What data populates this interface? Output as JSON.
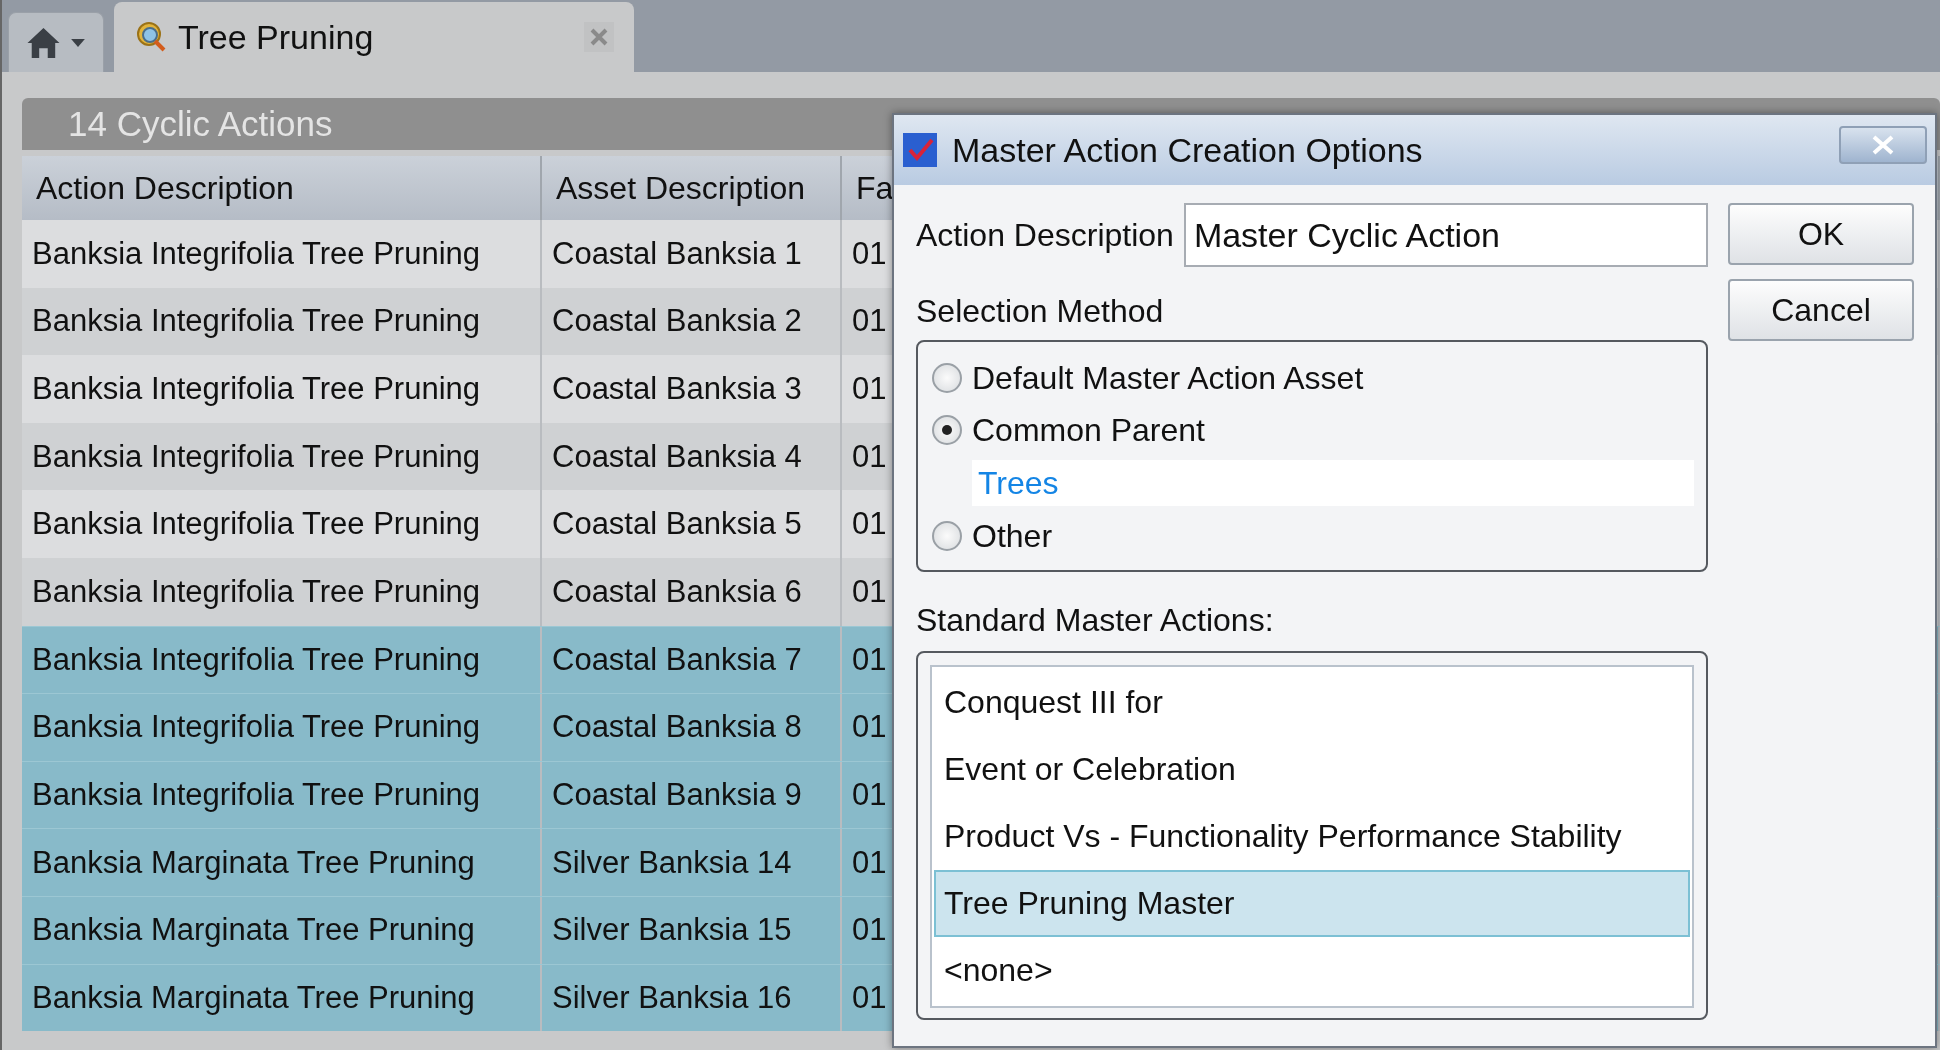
{
  "tabs": [
    {
      "label": "Tree Pruning",
      "selected": true
    }
  ],
  "panel": {
    "title": "14 Cyclic Actions"
  },
  "table": {
    "columns": [
      "Action Description",
      "Asset Description",
      "Fa"
    ],
    "rows": [
      {
        "cells": [
          "Banksia Integrifolia Tree Pruning",
          "Coastal Banksia 1",
          "01"
        ],
        "selected": false
      },
      {
        "cells": [
          "Banksia Integrifolia Tree Pruning",
          "Coastal Banksia 2",
          "01"
        ],
        "selected": false
      },
      {
        "cells": [
          "Banksia Integrifolia Tree Pruning",
          "Coastal Banksia 3",
          "01"
        ],
        "selected": false
      },
      {
        "cells": [
          "Banksia Integrifolia Tree Pruning",
          "Coastal Banksia 4",
          "01"
        ],
        "selected": false
      },
      {
        "cells": [
          "Banksia Integrifolia Tree Pruning",
          "Coastal Banksia 5",
          "01"
        ],
        "selected": false
      },
      {
        "cells": [
          "Banksia Integrifolia Tree Pruning",
          "Coastal Banksia 6",
          "01"
        ],
        "selected": false
      },
      {
        "cells": [
          "Banksia Integrifolia Tree Pruning",
          "Coastal Banksia 7",
          "01"
        ],
        "selected": true
      },
      {
        "cells": [
          "Banksia Integrifolia Tree Pruning",
          "Coastal Banksia 8",
          "01"
        ],
        "selected": true
      },
      {
        "cells": [
          "Banksia Integrifolia Tree Pruning",
          "Coastal Banksia 9",
          "01"
        ],
        "selected": true
      },
      {
        "cells": [
          "Banksia Marginata Tree Pruning",
          "Silver Banksia 14",
          "01"
        ],
        "selected": true
      },
      {
        "cells": [
          "Banksia Marginata Tree Pruning",
          "Silver Banksia 15",
          "01"
        ],
        "selected": true
      },
      {
        "cells": [
          "Banksia Marginata Tree Pruning",
          "Silver Banksia 16",
          "01"
        ],
        "selected": true
      }
    ]
  },
  "dialog": {
    "title": "Master Action Creation Options",
    "action_description": {
      "label": "Action Description",
      "value": "Master Cyclic Action"
    },
    "buttons": [
      "OK",
      "Cancel"
    ],
    "selection_method": {
      "label": "Selection Method",
      "options": [
        {
          "label": "Default Master Action Asset",
          "selected": false
        },
        {
          "label": "Common Parent",
          "selected": true,
          "value": "Trees"
        },
        {
          "label": "Other",
          "selected": false
        }
      ]
    },
    "standard_master_actions": {
      "label": "Standard Master Actions:",
      "items": [
        {
          "label": "Conquest III for",
          "selected": false
        },
        {
          "label": "Event or Celebration",
          "selected": false
        },
        {
          "label": "Product Vs - Functionality Performance Stability",
          "selected": false
        },
        {
          "label": "Tree Pruning Master",
          "selected": true
        },
        {
          "label": "<none>",
          "selected": false
        }
      ]
    }
  }
}
